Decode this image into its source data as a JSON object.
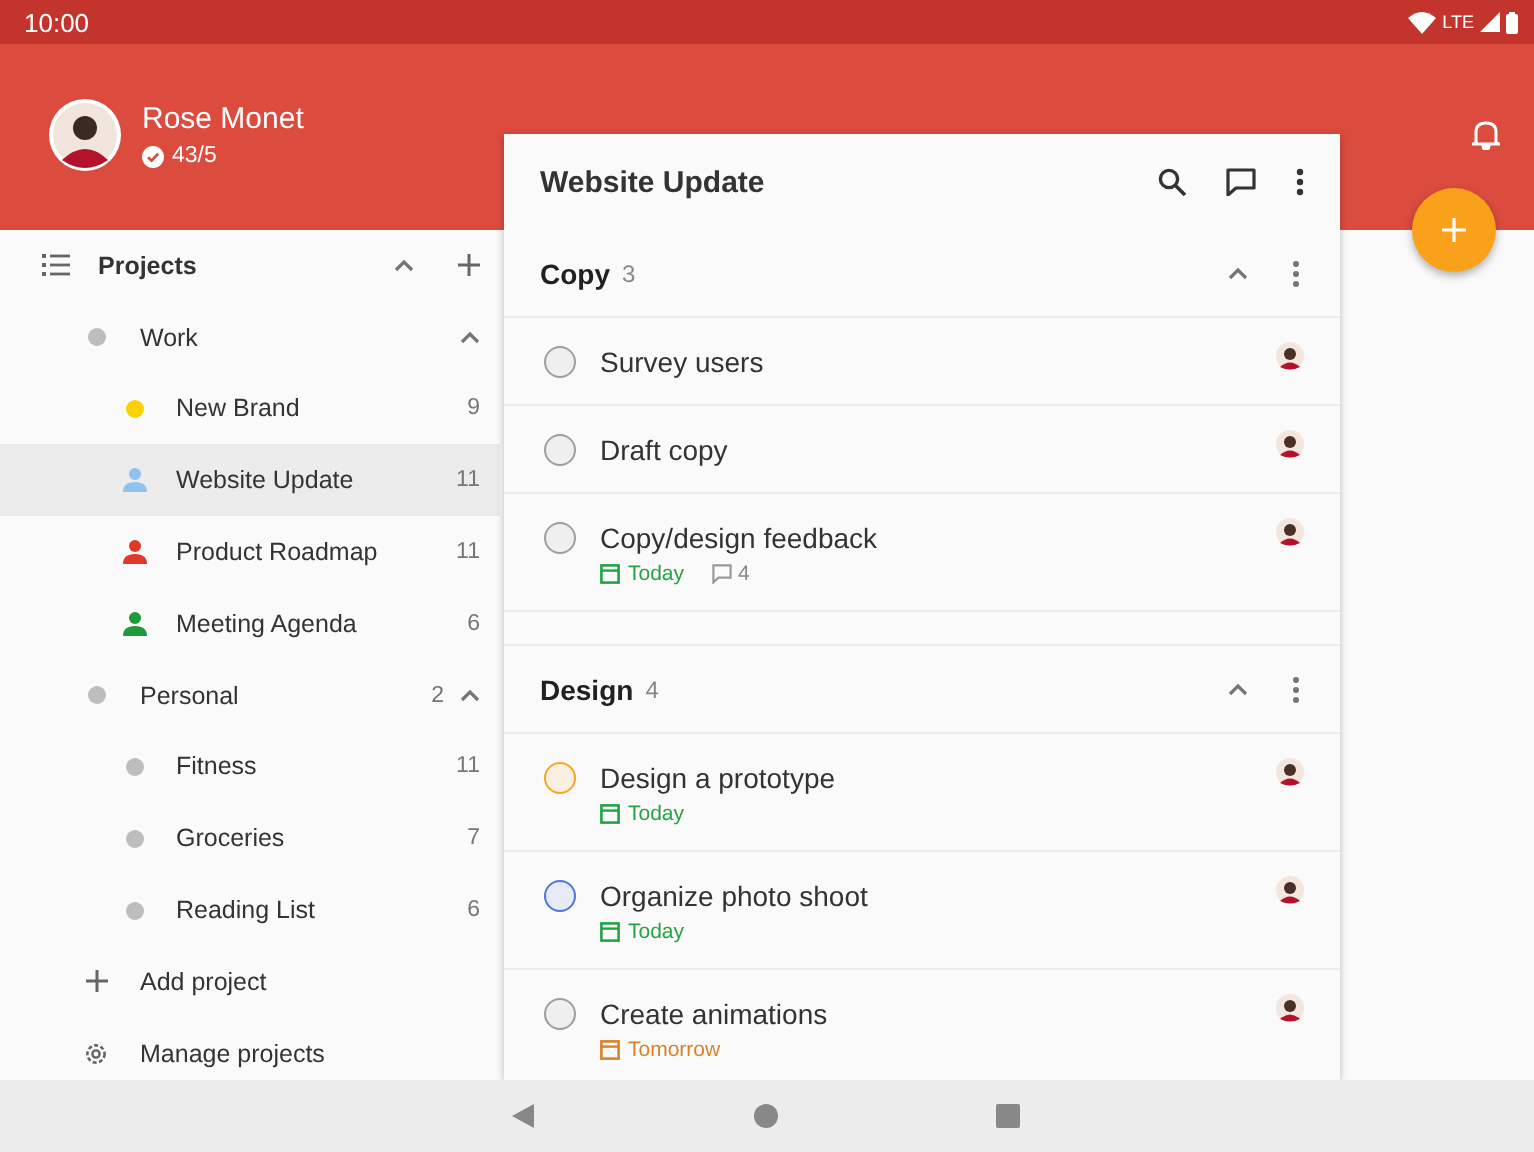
{
  "status_bar": {
    "time": "10:00",
    "network": "LTE"
  },
  "user": {
    "name": "Rose Monet",
    "karma": "43/5"
  },
  "sidebar": {
    "title": "Projects",
    "expanded": true,
    "items": [
      {
        "kind": "folder",
        "label": "Work",
        "color": "#bdbdbd",
        "selected": false,
        "expanded": true,
        "children": [
          {
            "kind": "dot",
            "label": "New Brand",
            "color": "#f9d100",
            "count": "9",
            "selected": false
          },
          {
            "kind": "person",
            "label": "Website Update",
            "color": "#90c2f0",
            "count": "11",
            "selected": true
          },
          {
            "kind": "person",
            "label": "Product Roadmap",
            "color": "#e0392b",
            "count": "11",
            "selected": false
          },
          {
            "kind": "person",
            "label": "Meeting Agenda",
            "color": "#1e9a3c",
            "count": "6",
            "selected": false
          }
        ]
      },
      {
        "kind": "folder",
        "label": "Personal",
        "color": "#bdbdbd",
        "count": "2",
        "selected": false,
        "expanded": true,
        "children": [
          {
            "kind": "dot",
            "label": "Fitness",
            "color": "#bdbdbd",
            "count": "11",
            "selected": false
          },
          {
            "kind": "dot",
            "label": "Groceries",
            "color": "#bdbdbd",
            "count": "7",
            "selected": false
          },
          {
            "kind": "dot",
            "label": "Reading List",
            "color": "#bdbdbd",
            "count": "6",
            "selected": false
          }
        ]
      }
    ],
    "actions": [
      {
        "kind": "add",
        "label": "Add project"
      },
      {
        "kind": "manage",
        "label": "Manage projects"
      }
    ]
  },
  "project": {
    "title": "Website Update",
    "sections": [
      {
        "name": "Copy",
        "count": "3",
        "expanded": true,
        "tasks": [
          {
            "title": "Survey users",
            "color": "#9e9e9e"
          },
          {
            "title": "Draft copy",
            "color": "#9e9e9e"
          },
          {
            "title": "Copy/design feedback",
            "color": "#9e9e9e",
            "due": {
              "text": "Today",
              "color": "#25a244"
            },
            "comments": "4"
          }
        ]
      },
      {
        "name": "Design",
        "count": "4",
        "expanded": true,
        "tasks": [
          {
            "title": "Design a prototype",
            "color": "#f5a623",
            "due": {
              "text": "Today",
              "color": "#25a244"
            }
          },
          {
            "title": "Organize photo shoot",
            "color": "#4a74e0",
            "due": {
              "text": "Today",
              "color": "#25a244"
            }
          },
          {
            "title": "Create animations",
            "color": "#9e9e9e",
            "due": {
              "text": "Tomorrow",
              "color": "#d9822b"
            }
          }
        ]
      }
    ]
  }
}
